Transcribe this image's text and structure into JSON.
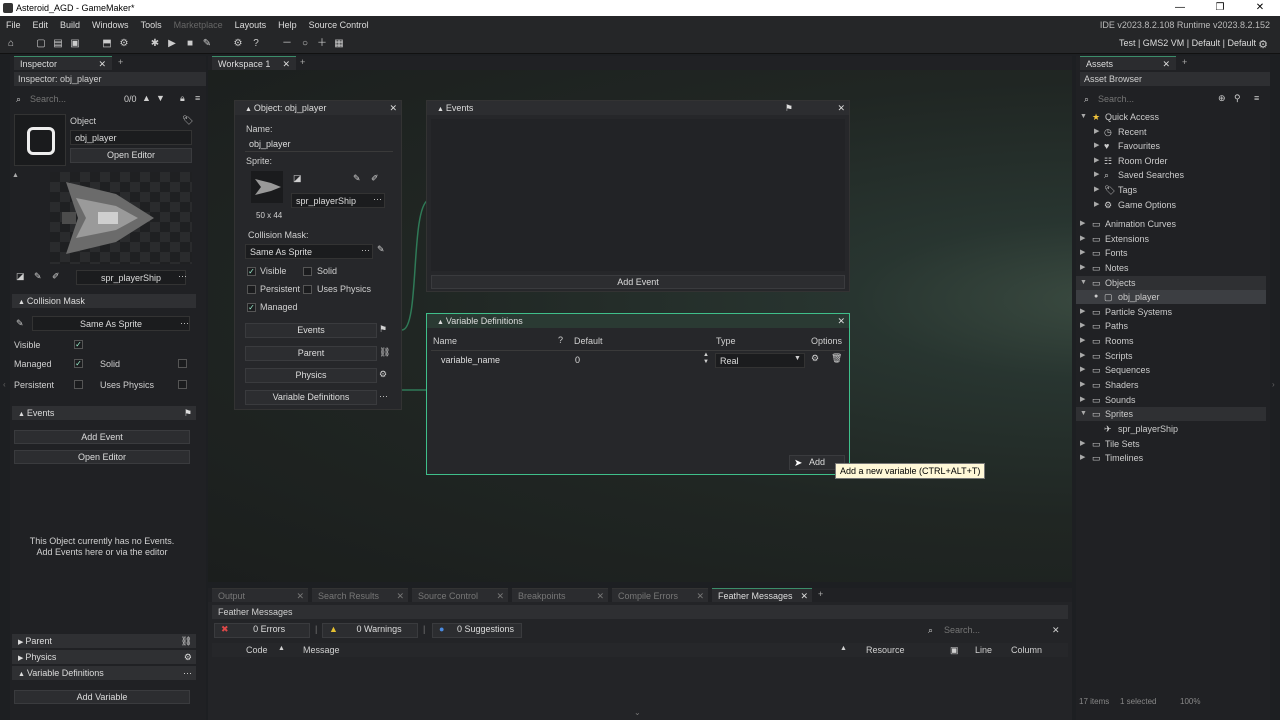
{
  "window": {
    "title": "Asteroid_AGD - GameMaker*",
    "controls": [
      "—",
      "❐",
      "✕"
    ]
  },
  "menu": {
    "items": [
      "File",
      "Edit",
      "Build",
      "Windows",
      "Tools",
      "Marketplace",
      "Layouts",
      "Help",
      "Source Control"
    ],
    "version": "IDE v2023.8.2.108  Runtime v2023.8.2.152"
  },
  "targets": {
    "text": "Test  |  GMS2 VM  |  Default  |  Default"
  },
  "inspector": {
    "tab": "Inspector",
    "header": "Inspector: obj_player",
    "search_placeholder": "Search...",
    "search_count": "0/0",
    "object_label": "Object",
    "object_name": "obj_player",
    "open_editor": "Open Editor",
    "sprite_name": "spr_playerShip",
    "collision_mask": "Collision Mask",
    "mask_value": "Same As Sprite",
    "visible": "Visible",
    "managed": "Managed",
    "solid": "Solid",
    "persistent": "Persistent",
    "uses_physics": "Uses Physics",
    "events": "Events",
    "add_event": "Add Event",
    "open_editor2": "Open Editor",
    "no_events_1": "This Object currently has no Events.",
    "no_events_2": "Add Events here or via the editor",
    "parent": "Parent",
    "physics": "Physics",
    "variable_definitions": "Variable Definitions",
    "add_variable": "Add Variable"
  },
  "workspace": {
    "tab": "Workspace 1"
  },
  "object_window": {
    "title": "Object: obj_player",
    "name_label": "Name:",
    "name_value": "obj_player",
    "sprite_label": "Sprite:",
    "sprite_value": "spr_playerShip",
    "sprite_size": "50 x 44",
    "mask_label": "Collision Mask:",
    "mask_value": "Same As Sprite",
    "visible": "Visible",
    "solid": "Solid",
    "persistent": "Persistent",
    "uses_physics": "Uses Physics",
    "managed": "Managed",
    "btn_events": "Events",
    "btn_parent": "Parent",
    "btn_physics": "Physics",
    "btn_vardefs": "Variable Definitions"
  },
  "events_window": {
    "title": "Events",
    "add_event": "Add Event"
  },
  "vardefs_window": {
    "title": "Variable Definitions",
    "col_name": "Name",
    "col_default": "Default",
    "col_type": "Type",
    "col_options": "Options",
    "row": {
      "name": "variable_name",
      "default": "0",
      "type": "Real"
    },
    "add": "Add",
    "tooltip": "Add a new variable (CTRL+ALT+T)"
  },
  "assets": {
    "tab": "Assets",
    "header": "Asset Browser",
    "search_placeholder": "Search...",
    "quick_access": "Quick Access",
    "qa_items": [
      "Recent",
      "Favourites",
      "Room Order",
      "Saved Searches",
      "Tags",
      "Game Options"
    ],
    "groups": [
      "Animation Curves",
      "Extensions",
      "Fonts",
      "Notes",
      "Objects"
    ],
    "obj_child": "obj_player",
    "groups2": [
      "Particle Systems",
      "Paths",
      "Rooms",
      "Scripts",
      "Sequences",
      "Shaders",
      "Sounds",
      "Sprites"
    ],
    "spr_child": "spr_playerShip",
    "groups3": [
      "Tile Sets",
      "Timelines"
    ],
    "footer_items": "17 items",
    "footer_selected": "1 selected",
    "footer_zoom": "100%"
  },
  "bottom": {
    "tabs": [
      "Output",
      "Search Results",
      "Source Control",
      "Breakpoints",
      "Compile Errors",
      "Feather Messages"
    ],
    "panel_title": "Feather Messages",
    "errors": "0 Errors",
    "warnings": "0 Warnings",
    "suggestions": "0 Suggestions",
    "search_placeholder": "Search...",
    "cols": [
      "Code",
      "Message",
      "Resource",
      "Line",
      "Column"
    ]
  },
  "colors": {
    "accent": "#3fbf8a",
    "background": "#1d1f22",
    "tooltip": "#fff8d8"
  }
}
